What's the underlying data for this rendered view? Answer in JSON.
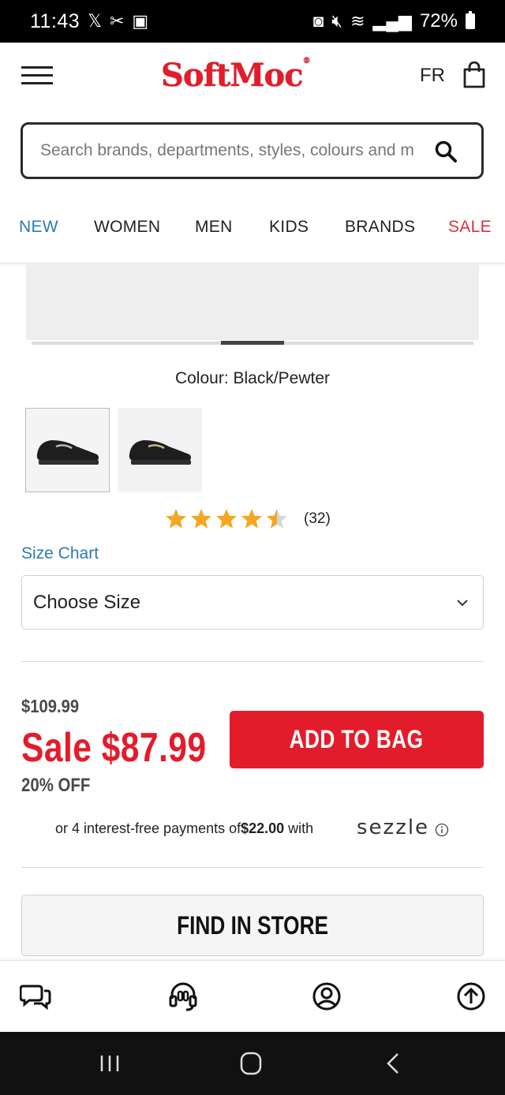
{
  "status_bar": {
    "time": "11:43",
    "battery": "72%"
  },
  "header": {
    "logo": "SoftMoc",
    "language": "FR"
  },
  "search": {
    "placeholder": "Search brands, departments, styles, colours and m"
  },
  "nav": {
    "items": [
      "NEW",
      "WOMEN",
      "MEN",
      "KIDS",
      "BRANDS",
      "SALE"
    ],
    "colors": {
      "new": "#2b7bb5",
      "sale": "#d9303f"
    }
  },
  "product": {
    "colour_label": "Colour: Black/Pewter",
    "rating": 4.5,
    "review_count": "(32)",
    "size_chart_label": "Size Chart",
    "size_select_label": "Choose Size",
    "original_price": "$109.99",
    "sale_price": "Sale $87.99",
    "discount": "20% OFF",
    "add_to_bag_label": "ADD TO BAG",
    "sezzle_text_prefix": "or 4 interest-free payments of ",
    "sezzle_amount": "$22.00",
    "sezzle_text_suffix": " with",
    "sezzle_brand": "sezzle",
    "find_in_store_label": "FIND IN STORE"
  },
  "bottom_bar": {
    "icons": [
      "chat-icon",
      "headset-icon",
      "account-icon",
      "scroll-top-icon"
    ]
  },
  "colors": {
    "brand_red": "#e31c2b",
    "link_blue": "#2b7bb5",
    "star_gold": "#f5a623"
  }
}
